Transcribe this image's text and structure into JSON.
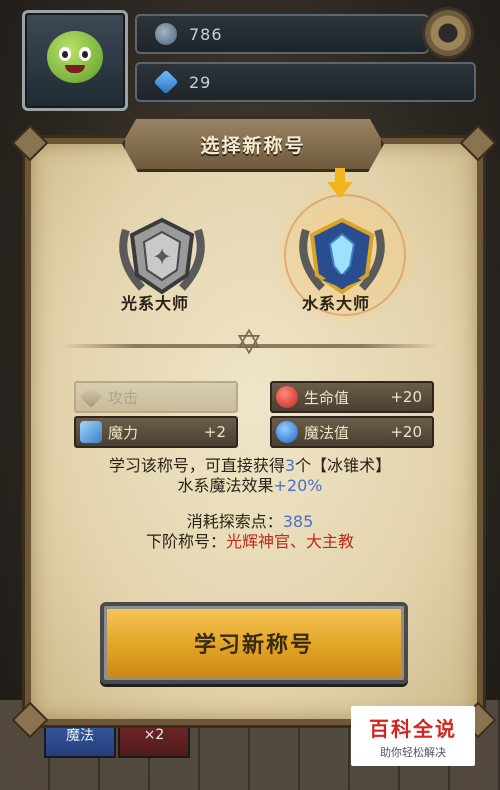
{
  "hud": {
    "ore_count": "786",
    "gem_count": "29"
  },
  "dialog": {
    "title": "选择新称号",
    "option_left": "光系大师",
    "option_right": "水系大师",
    "stats": [
      {
        "label": "攻击",
        "value": "",
        "icon": "sword-icon",
        "enabled": false
      },
      {
        "label": "魔力",
        "value": "+2",
        "icon": "staff-icon",
        "enabled": true
      },
      {
        "label": "生命值",
        "value": "+20",
        "icon": "red-potion-icon",
        "enabled": true
      },
      {
        "label": "魔法值",
        "value": "+20",
        "icon": "blue-potion-icon",
        "enabled": true
      }
    ],
    "desc_line1_a": "学习该称号，可直接获得",
    "desc_line1_b": "3",
    "desc_line1_c": "个【冰锥术】",
    "desc_line2_a": "水系魔法效果",
    "desc_line2_b": "+20%",
    "cost_label": "消耗探索点：",
    "cost_value": "385",
    "next_label": "下阶称号：",
    "next_value": "光辉神官、大主教",
    "learn_button": "学习新称号"
  },
  "footer": {
    "card1": "魔法",
    "card2": "×2"
  },
  "watermark": {
    "line1": "百科全说",
    "line2": "助你轻松解决"
  },
  "colors": {
    "parchment": "#e3d4ad",
    "highlight_blue": "#4a6fc9",
    "highlight_red": "#c02a1a",
    "button_gold": "#e0a022"
  }
}
